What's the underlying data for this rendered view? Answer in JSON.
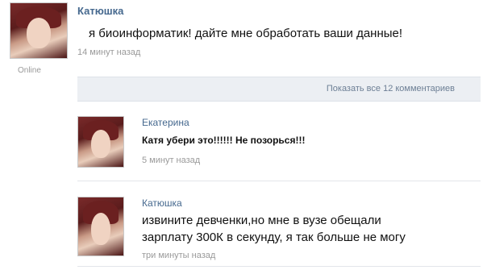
{
  "post": {
    "author": "Катюшка",
    "text": "я биоинформатик! дайте мне обработать ваши данные!",
    "time": "14 минут назад",
    "status": "Online"
  },
  "comments_bar": {
    "show_all_label": "Показать все 12 комментариев"
  },
  "comments": [
    {
      "author": "Екатерина",
      "text": "Катя убери это!!!!!! Не позорься!!!",
      "time": "5 минут назад"
    },
    {
      "author": "Катюшка",
      "text_line1": "извините девченки,но мне в вузе обещали",
      "text_line2": "зарплату 300К в секунду,  я так больше не могу",
      "time": "три минуты назад"
    }
  ]
}
